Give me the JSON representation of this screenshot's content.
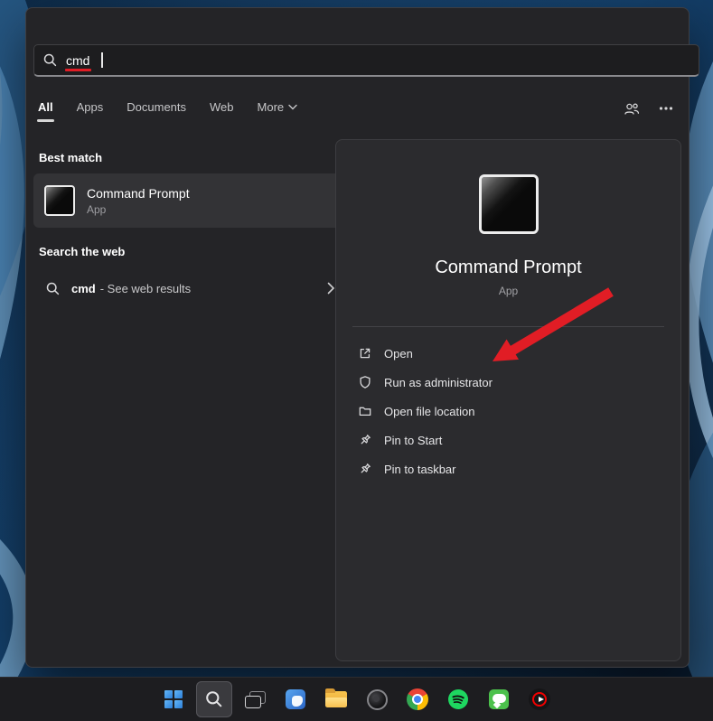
{
  "search": {
    "query": "cmd"
  },
  "tabs": {
    "items": [
      {
        "label": "All",
        "active": true
      },
      {
        "label": "Apps",
        "active": false
      },
      {
        "label": "Documents",
        "active": false
      },
      {
        "label": "Web",
        "active": false
      },
      {
        "label": "More",
        "active": false
      }
    ]
  },
  "best_match": {
    "heading": "Best match",
    "result": {
      "title": "Command Prompt",
      "subtitle": "App"
    }
  },
  "web_search": {
    "heading": "Search the web",
    "result": {
      "query": "cmd",
      "suffix": "- See web results"
    }
  },
  "preview": {
    "app_title": "Command Prompt",
    "app_subtitle": "App",
    "actions": [
      {
        "label": "Open"
      },
      {
        "label": "Run as administrator"
      },
      {
        "label": "Open file location"
      },
      {
        "label": "Pin to Start"
      },
      {
        "label": "Pin to taskbar"
      }
    ]
  },
  "taskbar": {
    "items": [
      {
        "name": "start"
      },
      {
        "name": "search",
        "active": true
      },
      {
        "name": "task-view"
      },
      {
        "name": "widgets"
      },
      {
        "name": "file-explorer"
      },
      {
        "name": "camera-app"
      },
      {
        "name": "chrome"
      },
      {
        "name": "spotify"
      },
      {
        "name": "chat-app"
      },
      {
        "name": "youtube-music"
      }
    ]
  },
  "icons": {
    "search": "magnifier",
    "account": "people",
    "options": "ellipsis",
    "more_tab": "chevron-down",
    "web_result": "chevron-right",
    "open": "open-external",
    "run_as_administrator": "shield",
    "open_file_location": "folder",
    "pin_to_start": "pushpin",
    "pin_to_taskbar": "pushpin",
    "command_prompt": "terminal-window",
    "windows_logo": "four-squares"
  },
  "colors": {
    "annotation_red": "#e11d25",
    "panel_bg": "#242427",
    "result_card_bg": "#333336",
    "taskbar_bg": "#1d1d20",
    "active_tab_underline": "#d6d6d6"
  }
}
